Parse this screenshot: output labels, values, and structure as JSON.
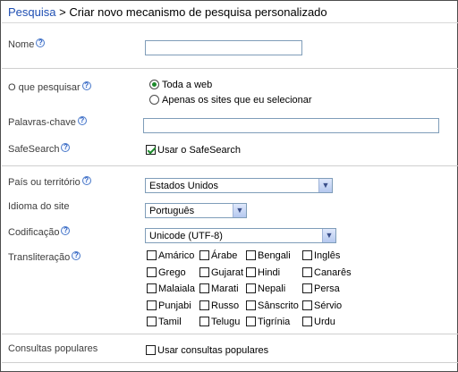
{
  "header": {
    "breadcrumb_link": "Pesquisa",
    "separator": " > ",
    "title": "Criar novo mecanismo de pesquisa personalizado"
  },
  "fields": {
    "name": {
      "label": "Nome",
      "value": ""
    },
    "what_to_search": {
      "label": "O que pesquisar",
      "options": [
        "Toda a web",
        "Apenas os sites que eu selecionar"
      ],
      "selected": "Toda a web"
    },
    "keywords": {
      "label": "Palavras-chave",
      "value": ""
    },
    "safesearch": {
      "label": "SafeSearch",
      "checkbox_label": "Usar o SafeSearch",
      "checked": true
    },
    "country": {
      "label": "País ou território",
      "value": "Estados Unidos"
    },
    "site_language": {
      "label": "Idioma do site",
      "value": "Português"
    },
    "encoding": {
      "label": "Codificação",
      "value": "Unicode (UTF-8)"
    },
    "transliteration": {
      "label": "Transliteração",
      "languages": [
        "Amárico",
        "Árabe",
        "Bengali",
        "Inglês",
        "Grego",
        "Gujarat",
        "Hindi",
        "Canarês",
        "Malaiala",
        "Marati",
        "Nepali",
        "Persa",
        "Punjabi",
        "Russo",
        "Sânscrito",
        "Sérvio",
        "Tamil",
        "Telugu",
        "Tigrínia",
        "Urdu"
      ]
    },
    "popular_queries": {
      "label": "Consultas populares",
      "checkbox_label": "Usar consultas populares",
      "checked": false
    }
  },
  "help_glyph": "?",
  "dropdown_arrow": "▼",
  "colors": {
    "link": "#1f4fb3",
    "check": "#1c8a2b",
    "border": "#7f9db9"
  }
}
